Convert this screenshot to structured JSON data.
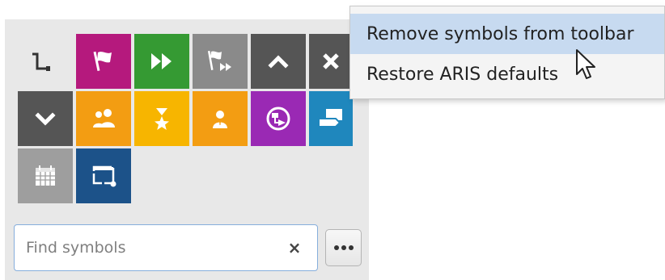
{
  "colors": {
    "panel_bg": "#e8e8e8",
    "magenta": "#b5197d",
    "green": "#359a33",
    "grey": "#8a8a8a",
    "dark_grey": "#555555",
    "orange": "#f39d12",
    "yellow": "#f7b500",
    "purple": "#9a29b4",
    "blue": "#1f87bd",
    "light_grey": "#9e9e9e",
    "navy": "#1c5289",
    "menu_hover": "#c7daf0"
  },
  "symbols": [
    {
      "icon": "connection-icon",
      "color": "transparent"
    },
    {
      "icon": "start-flag-icon",
      "color": "#b5197d"
    },
    {
      "icon": "fast-forward-icon",
      "color": "#359a33"
    },
    {
      "icon": "process-flags-icon",
      "color": "#8a8a8a"
    },
    {
      "icon": "chevron-up-icon",
      "color": "#555555"
    },
    {
      "icon": "close-icon",
      "color": "#555555"
    },
    {
      "icon": "chevron-down-icon",
      "color": "#555555"
    },
    {
      "icon": "group-icon",
      "color": "#f39d12"
    },
    {
      "icon": "award-icon",
      "color": "#f7b500"
    },
    {
      "icon": "person-icon",
      "color": "#f39d12"
    },
    {
      "icon": "process-interface-icon",
      "color": "#9a29b4"
    },
    {
      "icon": "screen-tag-icon",
      "color": "#1f87bd"
    },
    {
      "icon": "calendar-icon",
      "color": "#9e9e9e"
    },
    {
      "icon": "window-icon",
      "color": "#1c5289"
    }
  ],
  "search": {
    "placeholder": "Find symbols",
    "clear_label": "×"
  },
  "more_button": {
    "icon": "ellipsis-icon"
  },
  "context_menu": {
    "items": [
      {
        "label": "Remove symbols from toolbar",
        "hovered": true
      },
      {
        "label": "Restore ARIS defaults",
        "hovered": false
      }
    ]
  }
}
